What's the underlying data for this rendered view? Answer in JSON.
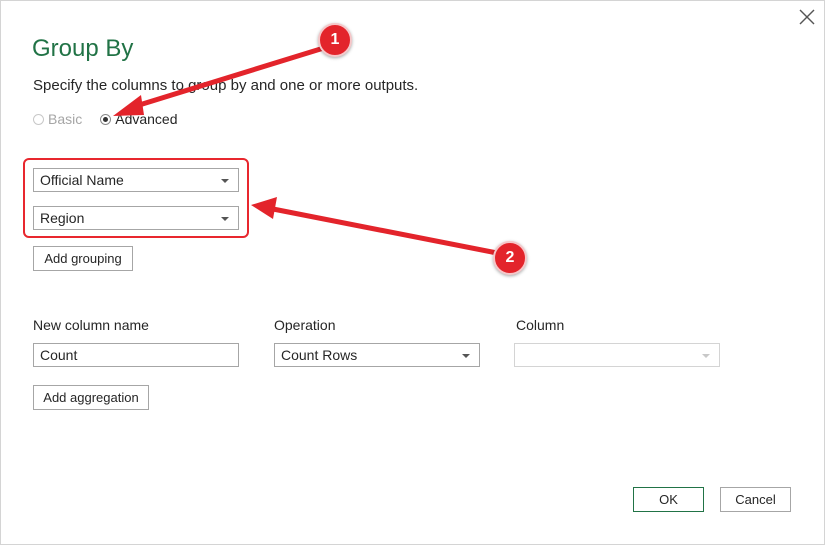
{
  "dialog": {
    "title": "Group By",
    "subtitle": "Specify the columns to group by and one or more outputs.",
    "close_icon": "close-icon"
  },
  "mode": {
    "basic_label": "Basic",
    "advanced_label": "Advanced",
    "selected": "Advanced"
  },
  "grouping": {
    "fields": [
      "Official Name",
      "Region"
    ],
    "add_label": "Add grouping"
  },
  "aggregation": {
    "new_column_header": "New column name",
    "operation_header": "Operation",
    "column_header": "Column",
    "new_column_value": "Count",
    "operation_value": "Count Rows",
    "column_value": "",
    "add_label": "Add aggregation"
  },
  "footer": {
    "ok_label": "OK",
    "cancel_label": "Cancel"
  },
  "annotations": {
    "badge_1": "1",
    "badge_2": "2",
    "accent_color": "#e3242b"
  },
  "colors": {
    "title": "#217346",
    "ok_border": "#217346"
  }
}
